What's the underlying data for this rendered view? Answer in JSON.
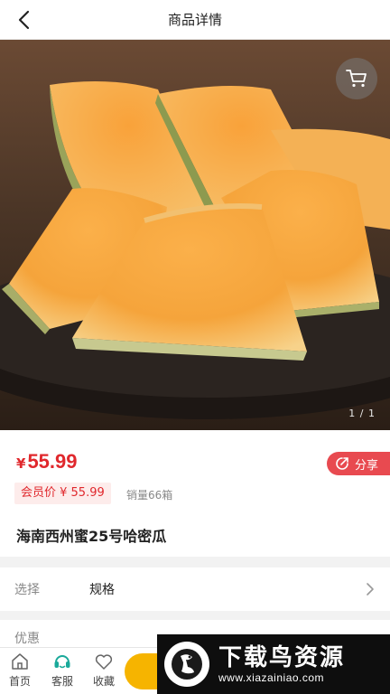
{
  "header": {
    "title": "商品详情",
    "back_icon": "back-arrow-icon"
  },
  "gallery": {
    "counter": "1 / 1",
    "cart_icon": "cart-icon"
  },
  "product": {
    "currency": "¥",
    "price": "55.99",
    "member_price_label": "会员价 ¥ 55.99",
    "sales": "销量66箱",
    "name": "海南西州蜜25号哈密瓜"
  },
  "share": {
    "label": "分享",
    "icon": "share-icon"
  },
  "spec": {
    "label": "选择",
    "value": "规格"
  },
  "promo": {
    "label": "优惠"
  },
  "bottom_bar": {
    "tabs": [
      {
        "label": "首页",
        "icon": "home-icon"
      },
      {
        "label": "客服",
        "icon": "headset-icon"
      },
      {
        "label": "收藏",
        "icon": "heart-icon"
      }
    ]
  },
  "watermark": {
    "title": "下载鸟资源",
    "url": "www.xiazainiao.com"
  },
  "colors": {
    "accent_red": "#e0282d",
    "share_red": "#e84a50",
    "buy_yellow": "#f6b400",
    "teal": "#1aa99a"
  }
}
